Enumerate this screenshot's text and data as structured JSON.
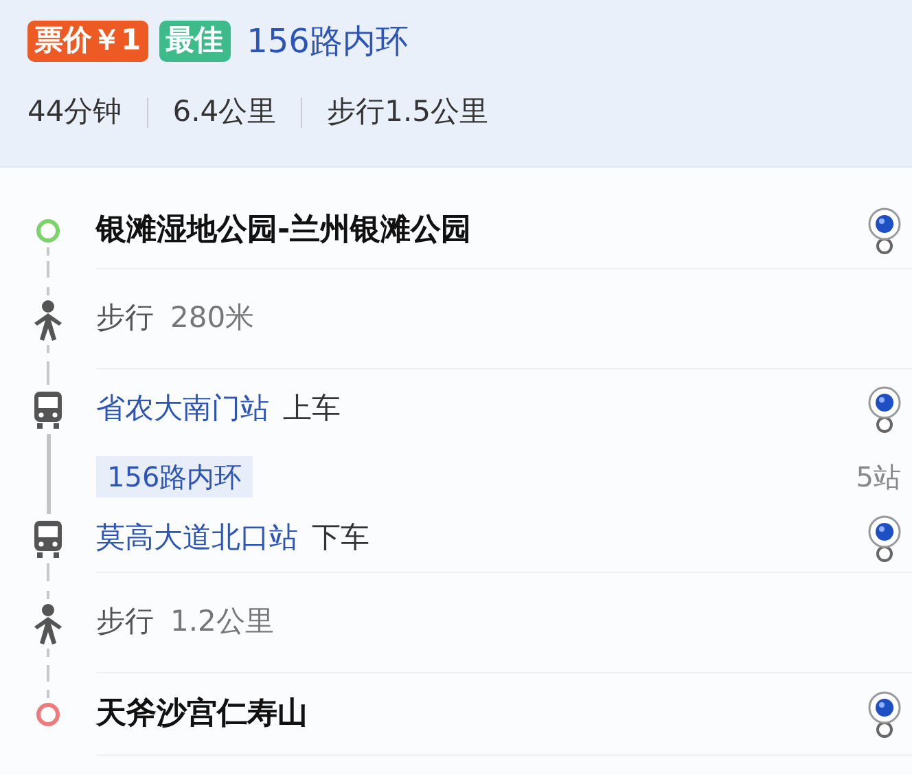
{
  "summary": {
    "badges": [
      {
        "label": "票价￥1",
        "color": "#ee5a24"
      },
      {
        "label": "最佳",
        "color": "#3dbb8a"
      }
    ],
    "route_name": "156路内环",
    "stats": [
      "44分钟",
      "6.4公里",
      "步行1.5公里"
    ]
  },
  "steps": [
    {
      "kind": "start",
      "text": "银滩湿地公园-兰州银滩公园"
    },
    {
      "kind": "walk",
      "action": "步行",
      "distance": "280米"
    },
    {
      "kind": "board",
      "stop": "省农大南门站",
      "action": "上车",
      "line": "156路内环",
      "stops": "5站"
    },
    {
      "kind": "alight",
      "stop": "莫高大道北口站",
      "action": "下车"
    },
    {
      "kind": "walk",
      "action": "步行",
      "distance": "1.2公里"
    },
    {
      "kind": "end",
      "text": "天斧沙宫仁寿山"
    }
  ]
}
